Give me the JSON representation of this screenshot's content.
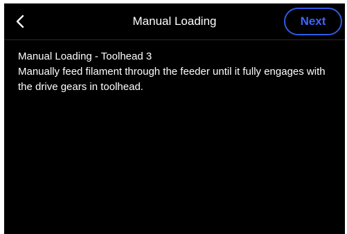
{
  "header": {
    "title": "Manual Loading",
    "next_label": "Next",
    "back_icon": "chevron-left-icon"
  },
  "content": {
    "heading": "Manual Loading - Toolhead 3",
    "instruction": "Manually feed filament through the feeder until it fully engages with the drive gears in toolhead."
  },
  "colors": {
    "background": "#000000",
    "text": "#ffffff",
    "accent": "#3d66ff"
  }
}
